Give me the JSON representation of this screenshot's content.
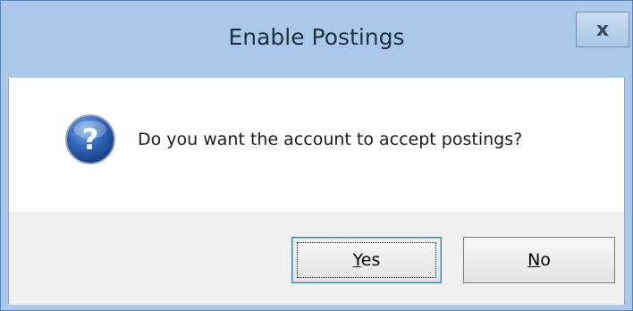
{
  "dialog": {
    "title": "Enable Postings",
    "close_glyph": "x",
    "icon": "question-icon",
    "message": "Do you want the account to accept postings?",
    "yes_button": {
      "mnemonic": "Y",
      "rest": "es"
    },
    "no_button": {
      "mnemonic": "N",
      "rest": "o"
    }
  },
  "colors": {
    "titlebar": "#aac9ea",
    "border": "#5b83b4",
    "footer": "#f0f0f0",
    "default_button_border": "#3c7fb1",
    "icon_blue": "#2f63b8"
  }
}
